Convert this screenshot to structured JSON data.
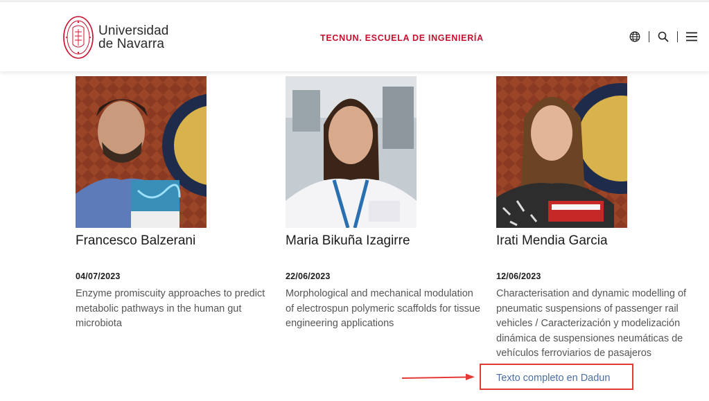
{
  "header": {
    "logo_line1": "Universidad",
    "logo_line2": "de Navarra",
    "school": "TECNUN. ESCUELA DE INGENIERÍA",
    "icons": [
      "globe-icon",
      "search-icon",
      "menu-icon"
    ]
  },
  "theses": [
    {
      "name": "Francesco Balzerani",
      "date": "04/07/2023",
      "title": "Enzyme promiscuity approaches to predict metabolic pathways in the human gut microbiota"
    },
    {
      "name": "Maria Bikuña Izagirre",
      "date": "22/06/2023",
      "title": "Morphological and mechanical modulation of electrospun polymeric scaffolds for tissue engineering applications"
    },
    {
      "name": "Irati Mendia Garcia",
      "date": "12/06/2023",
      "title": "Characterisation and dynamic modelling of pneumatic suspensions of passenger rail vehicles / Caracterización y modelización dinámica de suspensiones neumáticas de vehículos ferroviarios de pasajeros"
    }
  ],
  "full_text_link": "Texto completo en Dadun",
  "colors": {
    "brand_red": "#c8102e",
    "link_blue": "#4a6fa5",
    "annotation_red": "#e53935"
  }
}
